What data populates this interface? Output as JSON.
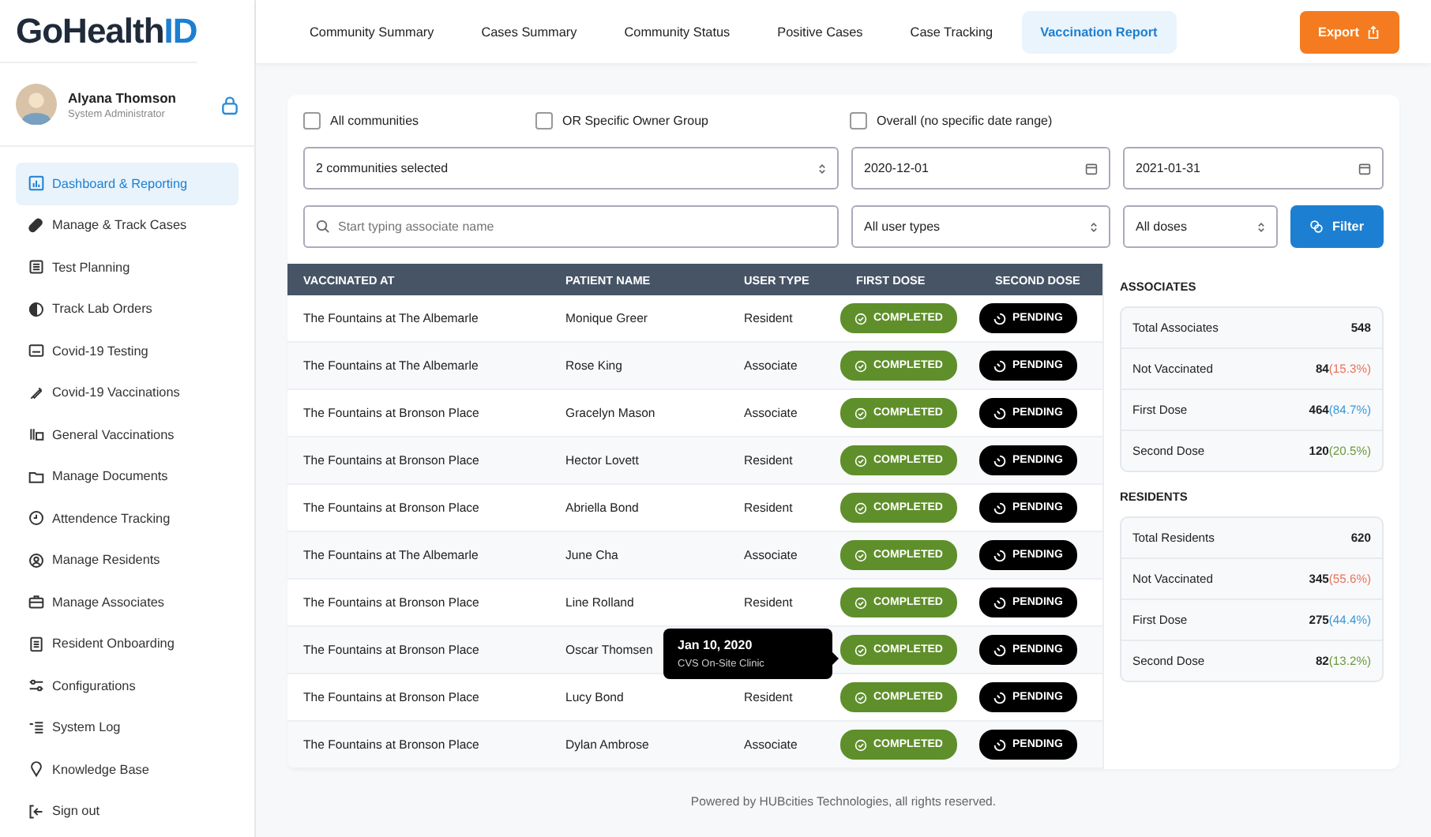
{
  "logo": {
    "main": "GoHealth",
    "accent": "ID"
  },
  "user": {
    "name": "Alyana Thomson",
    "role": "System Administrator"
  },
  "sidebar": {
    "items": [
      {
        "label": "Dashboard & Reporting",
        "selected": true
      },
      {
        "label": "Manage & Track Cases",
        "selected": false
      },
      {
        "label": "Test Planning",
        "selected": false
      },
      {
        "label": "Track Lab Orders",
        "selected": false
      },
      {
        "label": "Covid-19 Testing",
        "selected": false
      },
      {
        "label": "Covid-19 Vaccinations",
        "selected": false
      },
      {
        "label": "General Vaccinations",
        "selected": false
      },
      {
        "label": "Manage Documents",
        "selected": false
      },
      {
        "label": "Attendence Tracking",
        "selected": false
      },
      {
        "label": "Manage Residents",
        "selected": false
      },
      {
        "label": "Manage Associates",
        "selected": false
      },
      {
        "label": "Resident Onboarding",
        "selected": false
      },
      {
        "label": "Configurations",
        "selected": false
      },
      {
        "label": "System Log",
        "selected": false
      },
      {
        "label": "Knowledge Base",
        "selected": false
      },
      {
        "label": "Sign out",
        "selected": false
      }
    ]
  },
  "tabs": [
    {
      "label": "Community Summary",
      "selected": false
    },
    {
      "label": "Cases Summary",
      "selected": false
    },
    {
      "label": "Community Status",
      "selected": false
    },
    {
      "label": "Positive Cases",
      "selected": false
    },
    {
      "label": "Case Tracking",
      "selected": false
    },
    {
      "label": "Vaccination Report",
      "selected": true
    }
  ],
  "export_button": "Export",
  "filters": {
    "checkboxes": [
      {
        "label": "All communities",
        "checked": false
      },
      {
        "label": "OR Specific Owner Group",
        "checked": false
      },
      {
        "label": "Overall (no specific date range)",
        "checked": false
      }
    ],
    "communities": "2 communities selected",
    "date_from": "2020-12-01",
    "date_to": "2021-01-31",
    "search": {
      "placeholder": "Start typing associate name"
    },
    "user_type": "All user types",
    "doses": "All doses",
    "filter_button": "Filter"
  },
  "table": {
    "columns": [
      "VACCINATED AT",
      "PATIENT NAME",
      "USER TYPE",
      "FIRST DOSE",
      "SECOND DOSE"
    ],
    "rows": [
      {
        "vaccinated_at": "The Fountains at The Albemarle",
        "patient": "Monique Greer",
        "user_type": "Resident",
        "first_dose": "COMPLETED",
        "first_done": true,
        "second_dose": "PENDING",
        "second_done": false
      },
      {
        "vaccinated_at": "The Fountains at The Albemarle",
        "patient": "Rose King",
        "user_type": "Associate",
        "first_dose": "COMPLETED",
        "first_done": true,
        "second_dose": "PENDING",
        "second_done": false
      },
      {
        "vaccinated_at": "The Fountains at Bronson Place",
        "patient": "Gracelyn Mason",
        "user_type": "Associate",
        "first_dose": "COMPLETED",
        "first_done": true,
        "second_dose": "PENDING",
        "second_done": false
      },
      {
        "vaccinated_at": "The Fountains at Bronson Place",
        "patient": "Hector Lovett",
        "user_type": "Resident",
        "first_dose": "COMPLETED",
        "first_done": true,
        "second_dose": "PENDING",
        "second_done": false
      },
      {
        "vaccinated_at": "The Fountains at Bronson Place",
        "patient": "Abriella Bond",
        "user_type": "Resident",
        "first_dose": "COMPLETED",
        "first_done": true,
        "second_dose": "PENDING",
        "second_done": false
      },
      {
        "vaccinated_at": "The Fountains at The Albemarle",
        "patient": "June Cha",
        "user_type": "Associate",
        "first_dose": "COMPLETED",
        "first_done": true,
        "second_dose": "PENDING",
        "second_done": false
      },
      {
        "vaccinated_at": "The Fountains at Bronson Place",
        "patient": "Line Rolland",
        "user_type": "Resident",
        "first_dose": "COMPLETED",
        "first_done": true,
        "second_dose": "PENDING",
        "second_done": false
      },
      {
        "vaccinated_at": "The Fountains at Bronson Place",
        "patient": "Oscar Thomsen",
        "first_dose": "COMPLETED",
        "first_done": true,
        "second_dose": "PENDING",
        "second_done": false,
        "tooltip": {
          "date": "Jan 10, 2020",
          "place": "CVS On-Site Clinic"
        }
      },
      {
        "vaccinated_at": "The Fountains at Bronson Place",
        "patient": "Lucy Bond",
        "user_type": "Resident",
        "first_dose": "COMPLETED",
        "first_done": true,
        "second_dose": "PENDING",
        "second_done": false
      },
      {
        "vaccinated_at": "The Fountains at Bronson Place",
        "patient": "Dylan Ambrose",
        "user_type": "Associate",
        "first_dose": "COMPLETED",
        "first_done": true,
        "second_dose": "PENDING",
        "second_done": false
      }
    ]
  },
  "stats": [
    {
      "title": "ASSOCIATES",
      "rows": [
        {
          "label": "Total Associates",
          "value": "548"
        },
        {
          "label": "Not Vaccinated",
          "value": "84",
          "percent": "(15.3%)",
          "color": "#e8735a"
        },
        {
          "label": "First Dose",
          "value": "464",
          "percent": "(84.7%)",
          "color": "#3a9ad9"
        },
        {
          "label": "Second Dose",
          "value": "120",
          "percent": "(20.5%)",
          "color": "#6a9a3a"
        }
      ]
    },
    {
      "title": "RESIDENTS",
      "rows": [
        {
          "label": "Total Residents",
          "value": "620"
        },
        {
          "label": "Not Vaccinated",
          "value": "345",
          "percent": "(55.6%)",
          "color": "#e8735a"
        },
        {
          "label": "First Dose",
          "value": "275",
          "percent": "(44.4%)",
          "color": "#3a9ad9"
        },
        {
          "label": "Second Dose",
          "value": "82",
          "percent": "(13.2%)",
          "color": "#6a9a3a"
        }
      ]
    }
  ],
  "footer": "Powered by HUBcities Technologies, all rights reserved."
}
